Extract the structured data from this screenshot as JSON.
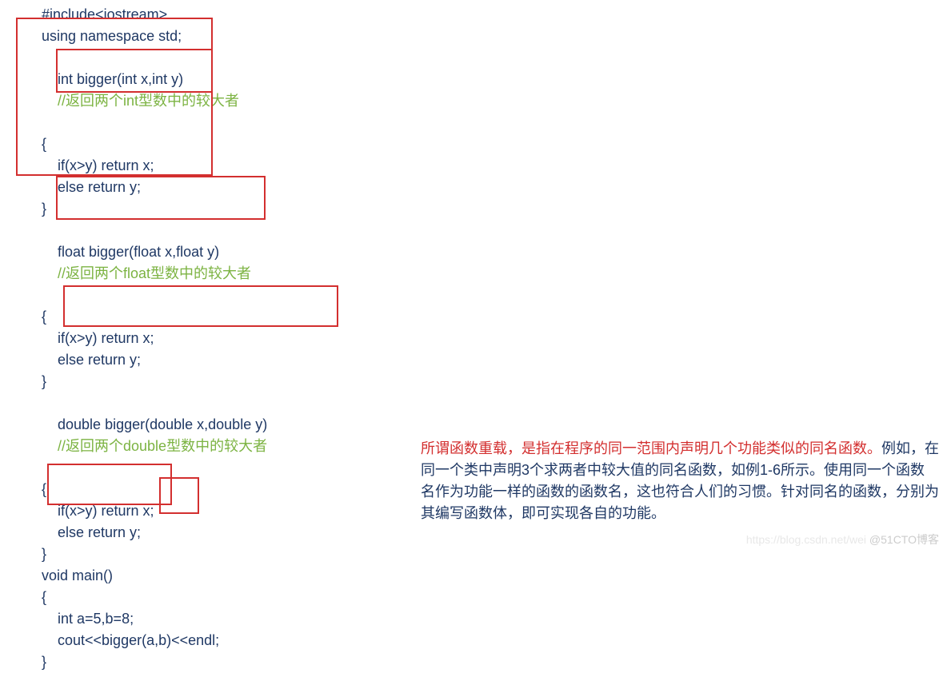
{
  "code": {
    "l1": "#include<iostream>",
    "l2": "using namespace std;",
    "blank1": "",
    "l3": "int bigger(int x,int y)",
    "c3": "//返回两个int型数中的较大者",
    "l4": "{",
    "l5": "    if(x>y) return x;",
    "l6": "    else return y;",
    "l7": "}",
    "l8": "float bigger(float x,float y)",
    "c8": "//返回两个float型数中的较大者",
    "l9": "{",
    "l10": "    if(x>y) return x;",
    "l11": "    else return y;",
    "l12": "}",
    "l13": "double bigger(double x,double y)",
    "c13": "//返回两个double型数中的较大者",
    "l14": "{",
    "l15": "    if(x>y) return x;",
    "l16": "    else return y;",
    "l17": "}",
    "blank2": "",
    "l18": "void main()",
    "l19": "{",
    "l20": "    int a=5,b=8;",
    "l21": "    cout<<bigger(a,b)<<endl;",
    "l22": "}"
  },
  "explanation": {
    "red_lead": "所谓函数重载，是指在程序的同一范围内声明几个功能类似的同名函数。",
    "blue_rest": "例如，在同一个类中声明3个求两者中较大值的同名函数，如例1-6所示。使用同一个函数名作为功能一样的函数的函数名，这也符合人们的习惯。针对同名的函数，分别为其编写函数体，即可实现各自的功能。"
  },
  "watermark": {
    "left": "https://blog.csdn.net/wei ",
    "right": "@51CTO博客"
  }
}
